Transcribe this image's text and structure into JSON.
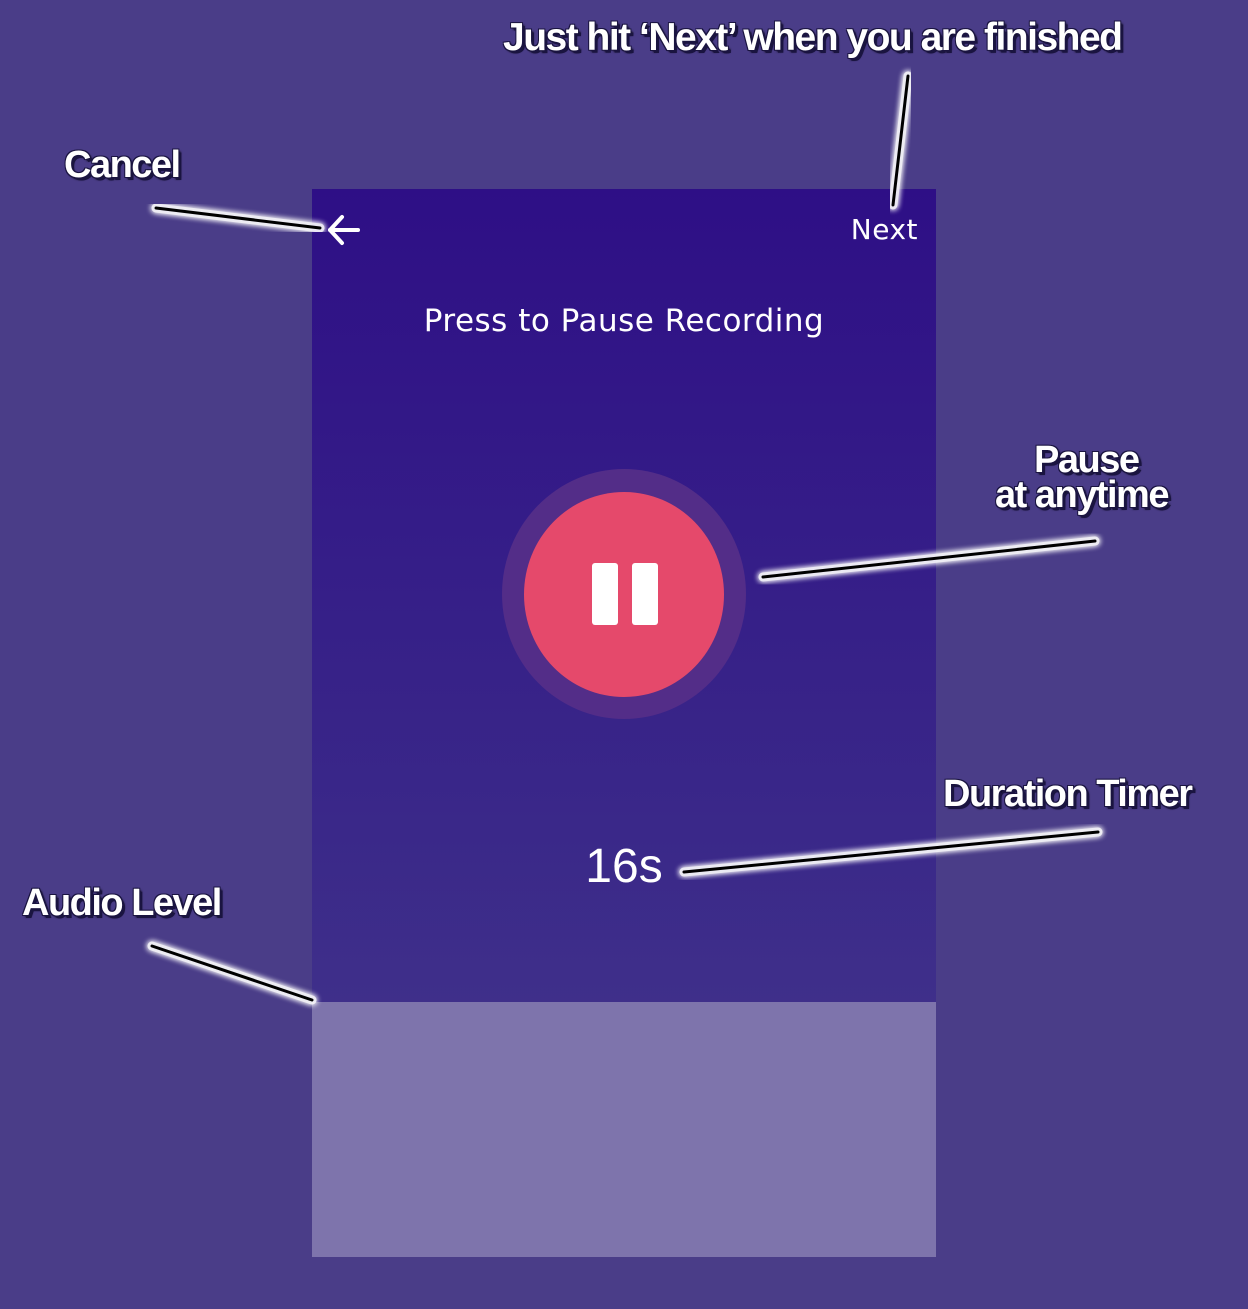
{
  "screen": {
    "next_label": "Next",
    "instruction": "Press to Pause Recording",
    "timer": "16s",
    "audio_level": 1.0
  },
  "annotations": {
    "next_hint": "Just hit ‘Next’ when you are finished",
    "cancel": "Cancel",
    "pause_line1": "Pause",
    "pause_line2": "at anytime",
    "duration": "Duration Timer",
    "audio": "Audio Level"
  },
  "colors": {
    "background": "#4a3d88",
    "screen_top": "#2e0f86",
    "screen_bottom": "#463a8b",
    "record_button": "#e5496b",
    "record_halo": "#532d88",
    "audio_level_panel": "#7e74ac",
    "text": "#ffffff"
  },
  "icons": {
    "back": "arrow-left-icon",
    "pause": "pause-icon"
  }
}
